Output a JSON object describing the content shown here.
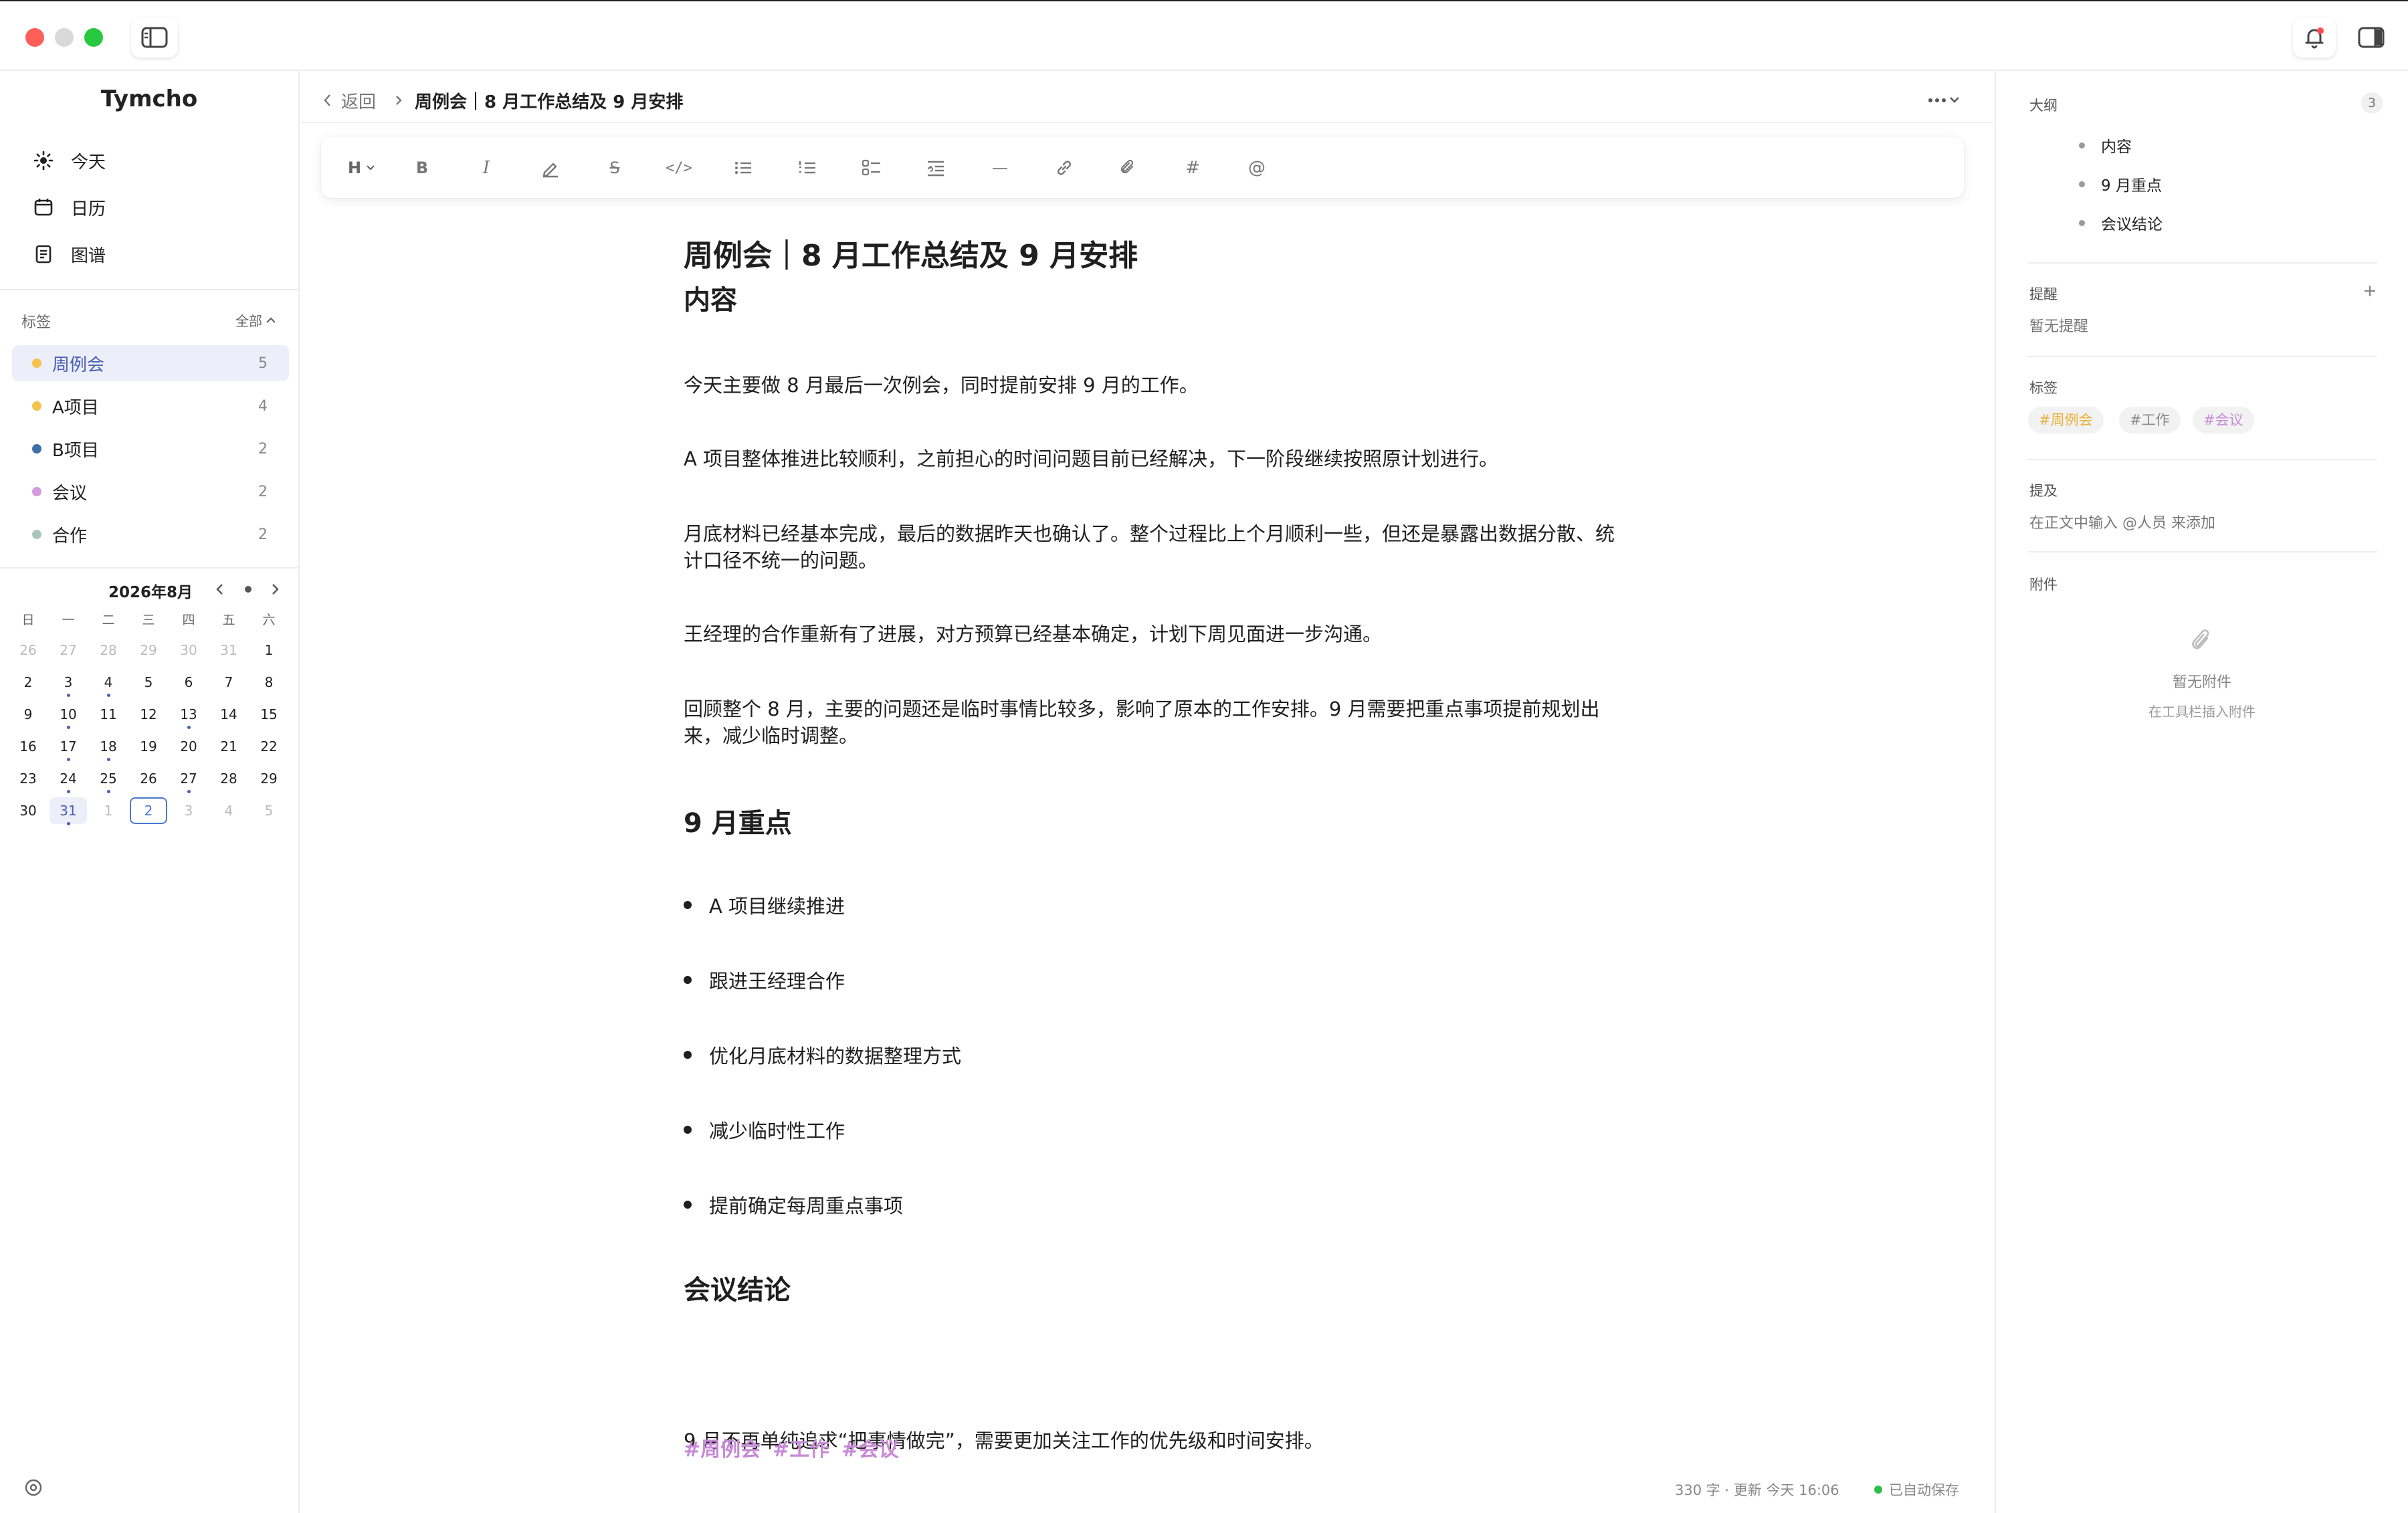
{
  "window": {
    "traffic_lights": [
      "#ff5f57",
      "#d9d9d9",
      "#28c840"
    ],
    "sidebar_toggle_icon": "sidebar-icon",
    "notification_icon": "bell-icon",
    "right_panel_icon": "panel-right-icon"
  },
  "sidebar": {
    "brand": "Tymcho",
    "nav": [
      {
        "label": "今天",
        "icon": "sun-icon"
      },
      {
        "label": "日历",
        "icon": "calendar-icon"
      },
      {
        "label": "图谱",
        "icon": "notebook-icon"
      }
    ],
    "tags_label": "标签",
    "tags_all": "全部",
    "tags": [
      {
        "name": "周例会",
        "count": "5",
        "color": "#f5c24c"
      },
      {
        "name": "A项目",
        "count": "4",
        "color": "#f5c24c"
      },
      {
        "name": "B项目",
        "count": "2",
        "color": "#3f6fa8"
      },
      {
        "name": "会议",
        "count": "2",
        "color": "#d39be0"
      },
      {
        "name": "合作",
        "count": "2",
        "color": "#a9c7b8"
      }
    ],
    "calendar": {
      "title": "2026年8月",
      "weekdays": [
        "日",
        "一",
        "二",
        "三",
        "四",
        "五",
        "六"
      ],
      "weeks": [
        [
          "26",
          "27",
          "28",
          "29",
          "30",
          "31",
          "1"
        ],
        [
          "2",
          "3",
          "4",
          "5",
          "6",
          "7",
          "8"
        ],
        [
          "9",
          "10",
          "11",
          "12",
          "13",
          "14",
          "15"
        ],
        [
          "16",
          "17",
          "18",
          "19",
          "20",
          "21",
          "22"
        ],
        [
          "23",
          "24",
          "25",
          "26",
          "27",
          "28",
          "29"
        ],
        [
          "30",
          "31",
          "1",
          "2",
          "3",
          "4",
          "5"
        ]
      ],
      "selected": "31",
      "today": "2"
    },
    "settings_icon": "settings-icon"
  },
  "main": {
    "back_label": "返回",
    "breadcrumb_title": "周例会｜8 月工作总结及 9 月安排",
    "more_icon": "more-icon",
    "toolbar": [
      {
        "label": "H",
        "icon": "heading-icon"
      },
      {
        "label": "B",
        "icon": "bold-icon"
      },
      {
        "label": "I",
        "icon": "italic-icon"
      },
      {
        "label": "",
        "icon": "highlight-icon"
      },
      {
        "label": "S",
        "icon": "strikethrough-icon"
      },
      {
        "label": "</>",
        "icon": "code-icon"
      },
      {
        "label": "",
        "icon": "bullet-list-icon"
      },
      {
        "label": "",
        "icon": "ordered-list-icon"
      },
      {
        "label": "",
        "icon": "task-list-icon"
      },
      {
        "label": "",
        "icon": "quote-icon"
      },
      {
        "label": "—",
        "icon": "divider-icon"
      },
      {
        "label": "",
        "icon": "link-icon"
      },
      {
        "label": "",
        "icon": "attachment-icon"
      },
      {
        "label": "#",
        "icon": "hashtag-icon"
      },
      {
        "label": "@",
        "icon": "mention-icon"
      }
    ],
    "doc": {
      "title": "周例会｜8 月工作总结及 9 月安排",
      "section1": "内容",
      "paragraphs": [
        "今天主要做 8 月最后一次例会，同时提前安排 9 月的工作。",
        "A 项目整体推进比较顺利，之前担心的时间问题目前已经解决，下一阶段继续按照原计划进行。",
        "月底材料已经基本完成，最后的数据昨天也确认了。整个过程比上个月顺利一些，但还是暴露出数据分散、统计口径不统一的问题。",
        "王经理的合作重新有了进展，对方预算已经基本确定，计划下周见面进一步沟通。",
        "回顾整个 8 月，主要的问题还是临时事情比较多，影响了原本的工作安排。9 月需要把重点事项提前规划出来，减少临时调整。"
      ],
      "section2": "9 月重点",
      "bullets": [
        "A 项目继续推进",
        "跟进王经理合作",
        "优化月底材料的数据整理方式",
        "减少临时性工作",
        "提前确定每周重点事项"
      ],
      "section3": "会议结论",
      "conclusion": "9 月不再单纯追求“把事情做完”，需要更加关注工作的优先级和时间安排。",
      "tags": [
        "#周例会",
        "#工作",
        "#会议"
      ]
    },
    "footer": {
      "stats": "330 字 · 更新 今天 16:06",
      "saved": "已自动保存",
      "saved_color": "#2fbf4a"
    }
  },
  "right": {
    "outline_label": "大纲",
    "outline_count": "3",
    "outline": [
      "内容",
      "9 月重点",
      "会议结论"
    ],
    "reminder_label": "提醒",
    "reminder_empty": "暂无提醒",
    "tags_label": "标签",
    "tags": [
      {
        "text": "#周例会",
        "color": "#e9b13a"
      },
      {
        "text": "#工作",
        "color": "#888888"
      },
      {
        "text": "#会议",
        "color": "#c88ad8"
      }
    ],
    "mention_label": "提及",
    "mention_hint": "在正文中输入 @人员 来添加",
    "attach_label": "附件",
    "attach_empty": "暂无附件",
    "attach_hint": "在工具栏插入附件"
  }
}
